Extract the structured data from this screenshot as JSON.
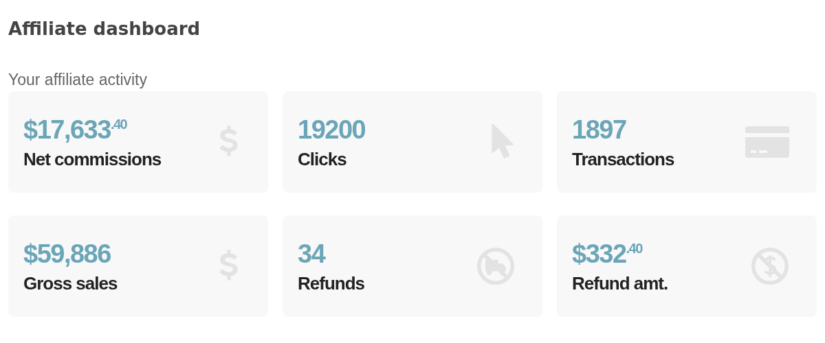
{
  "title": "Affiliate dashboard",
  "subtitle": "Your affiliate activity",
  "cards": [
    {
      "value": "$17,633$^{.40}$",
      "label": "Net commissions",
      "kind": "dollar"
    },
    {
      "value": "19200",
      "label": "Clicks",
      "kind": "cursor"
    },
    {
      "value": "1897",
      "label": "Transactions",
      "kind": "card"
    },
    {
      "value": "$59,886",
      "label": "Gross sales",
      "kind": "dollar"
    },
    {
      "value": "34",
      "label": "Refunds",
      "kind": "truck-ban"
    },
    {
      "value": "$332$^{.40}$",
      "label": "Refund amt.",
      "kind": "dollar-ban"
    }
  ]
}
